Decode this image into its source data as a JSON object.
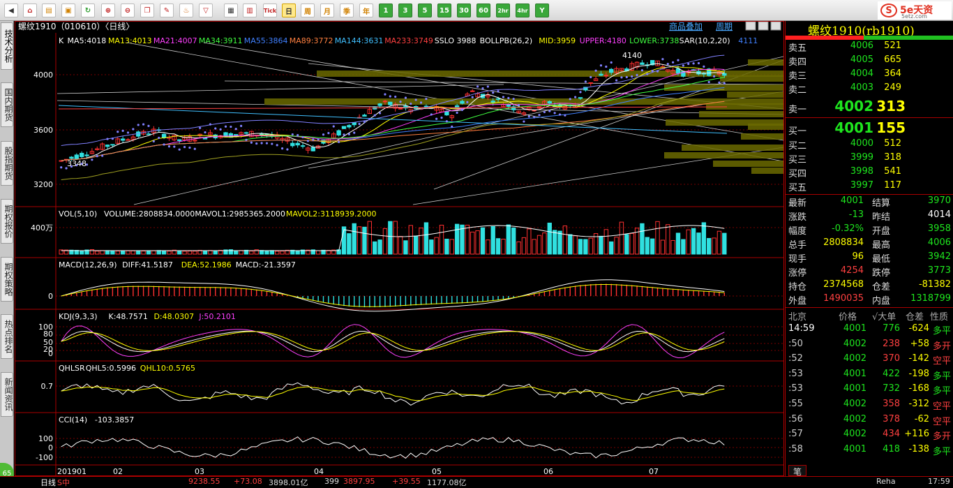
{
  "toolbar": {
    "buttons": [
      "back",
      "home",
      "folder",
      "stock",
      "refresh",
      "zoom-in",
      "zoom-out",
      "window",
      "pen",
      "flame",
      "filter",
      "table",
      "chart",
      "tick",
      "日",
      "周",
      "月",
      "季",
      "年",
      "1",
      "3",
      "5",
      "15",
      "30",
      "60",
      "2hr",
      "4hr",
      "Y"
    ]
  },
  "brand": {
    "name": "5e天资",
    "sub": "5etz.com"
  },
  "leftnav": [
    "技术分析",
    "国内期货",
    "股指期货",
    "期权报价",
    "期权策略",
    "热点排名",
    "新闻资讯"
  ],
  "chart": {
    "title": "螺纹1910（010610）〈日线〉",
    "topbtns": [
      "商品叠加",
      "周期"
    ],
    "ma_legend": [
      {
        "t": "K",
        "c": "#ffffff"
      },
      {
        "t": "MA5:4018",
        "c": "#ffffff"
      },
      {
        "t": "MA13:4013",
        "c": "#ffff00"
      },
      {
        "t": "MA21:4007",
        "c": "#ff40ff"
      },
      {
        "t": "MA34:3911",
        "c": "#40ff40"
      },
      {
        "t": "MA55:3864",
        "c": "#4080ff"
      },
      {
        "t": "MA89:3772",
        "c": "#ff8040"
      },
      {
        "t": "MA144:3631",
        "c": "#40c0ff"
      },
      {
        "t": "MA233:3749",
        "c": "#ff4040"
      },
      {
        "t": "SSLO 3988",
        "c": "#ffffff"
      },
      {
        "t": "BOLLPB(26,2)",
        "c": "#ffffff"
      },
      {
        "t": "MID:3959",
        "c": "#ffff00"
      },
      {
        "t": "UPPER:4180",
        "c": "#ff40ff"
      },
      {
        "t": "LOWER:3738",
        "c": "#40ff40"
      },
      {
        "t": "SAR(10,2,20)",
        "c": "#ffffff"
      },
      {
        "t": "4111",
        "c": "#4080ff"
      }
    ],
    "price_ticks": [
      "4000",
      "3600",
      "3200"
    ],
    "hi_label": "4140",
    "lo_label": "3348",
    "vol": {
      "legend": [
        {
          "t": "VOL(5,10)",
          "c": "#fff"
        },
        {
          "t": "VOLUME:2808834.0000",
          "c": "#fff"
        },
        {
          "t": "MAVOL1:2985365.2000",
          "c": "#fff"
        },
        {
          "t": "MAVOL2:3118939.2000",
          "c": "#ffff00"
        }
      ],
      "tick": "400万"
    },
    "macd": {
      "legend": [
        {
          "t": "MACD(12,26,9)",
          "c": "#fff"
        },
        {
          "t": "DIFF:41.5187",
          "c": "#fff"
        },
        {
          "t": "DEA:52.1986",
          "c": "#ffff00"
        },
        {
          "t": "MACD:-21.3597",
          "c": "#fff"
        }
      ],
      "tick": "0"
    },
    "kdj": {
      "legend": [
        {
          "t": "KDJ(9,3,3)",
          "c": "#fff"
        },
        {
          "t": "K:48.7571",
          "c": "#fff"
        },
        {
          "t": "D:48.0307",
          "c": "#ffff00"
        },
        {
          "t": "J:50.2101",
          "c": "#ff40ff"
        }
      ],
      "ticks": [
        "100",
        "80",
        "50",
        "20",
        "0"
      ]
    },
    "qhlsr": {
      "legend": [
        {
          "t": "QHLSR",
          "c": "#fff"
        },
        {
          "t": "QHL5:0.5996",
          "c": "#fff"
        },
        {
          "t": "QHL10:0.5765",
          "c": "#ffff00"
        }
      ],
      "tick": "0.7"
    },
    "cci": {
      "legend": [
        {
          "t": "CCI(14)",
          "c": "#fff"
        },
        {
          "t": "-103.3857",
          "c": "#fff"
        }
      ],
      "ticks": [
        "100",
        "0",
        "-100"
      ]
    },
    "dates": [
      "201901",
      "02",
      "03",
      "04",
      "05",
      "06",
      "07"
    ],
    "period_label": "日线"
  },
  "panel": {
    "title": "螺纹1910(rb1910)",
    "asks": [
      {
        "l": "卖五",
        "p": "4006",
        "v": "521"
      },
      {
        "l": "卖四",
        "p": "4005",
        "v": "665"
      },
      {
        "l": "卖三",
        "p": "4004",
        "v": "364"
      },
      {
        "l": "卖二",
        "p": "4003",
        "v": "249"
      },
      {
        "l": "卖一",
        "p": "4002",
        "v": "313"
      }
    ],
    "bids": [
      {
        "l": "买一",
        "p": "4001",
        "v": "155"
      },
      {
        "l": "买二",
        "p": "4000",
        "v": "512"
      },
      {
        "l": "买三",
        "p": "3999",
        "v": "318"
      },
      {
        "l": "买四",
        "p": "3998",
        "v": "541"
      },
      {
        "l": "买五",
        "p": "3997",
        "v": "117"
      }
    ],
    "stats": [
      {
        "l1": "最新",
        "v1": "4001",
        "c1": "g",
        "l2": "结算",
        "v2": "3970",
        "c2": "g"
      },
      {
        "l1": "涨跌",
        "v1": "-13",
        "c1": "g",
        "l2": "昨结",
        "v2": "4014",
        "c2": "w"
      },
      {
        "l1": "幅度",
        "v1": "-0.32%",
        "c1": "g",
        "l2": "开盘",
        "v2": "3958",
        "c2": "g"
      },
      {
        "l1": "总手",
        "v1": "2808834",
        "c1": "y",
        "l2": "最高",
        "v2": "4006",
        "c2": "g"
      },
      {
        "l1": "现手",
        "v1": "96",
        "c1": "y",
        "l2": "最低",
        "v2": "3942",
        "c2": "g"
      },
      {
        "l1": "涨停",
        "v1": "4254",
        "c1": "r",
        "l2": "跌停",
        "v2": "3773",
        "c2": "g"
      },
      {
        "l1": "持仓",
        "v1": "2374568",
        "c1": "y",
        "l2": "仓差",
        "v2": "-81382",
        "c2": "y"
      },
      {
        "l1": "外盘",
        "v1": "1490035",
        "c1": "r",
        "l2": "内盘",
        "v2": "1318799",
        "c2": "g"
      }
    ],
    "ticks_header": {
      "loc": "北京",
      "price": "价格",
      "vol": "√大单",
      "diff": "仓差",
      "nature": "性质"
    },
    "ticks": [
      {
        "t": "14:59",
        "p": "4001",
        "v": "776",
        "vc": "g",
        "d": "-624",
        "dc": "y",
        "n": "多平",
        "nc": "g"
      },
      {
        "t": ":50",
        "p": "4002",
        "v": "238",
        "vc": "r",
        "d": "+58",
        "dc": "y",
        "n": "多开",
        "nc": "r"
      },
      {
        "t": ":52",
        "p": "4002",
        "v": "370",
        "vc": "r",
        "d": "-142",
        "dc": "y",
        "n": "空平",
        "nc": "r"
      },
      {
        "t": ":53",
        "p": "4001",
        "v": "422",
        "vc": "g",
        "d": "-198",
        "dc": "y",
        "n": "多平",
        "nc": "g"
      },
      {
        "t": ":53",
        "p": "4001",
        "v": "732",
        "vc": "g",
        "d": "-168",
        "dc": "y",
        "n": "多平",
        "nc": "g"
      },
      {
        "t": ":55",
        "p": "4002",
        "v": "358",
        "vc": "r",
        "d": "-312",
        "dc": "y",
        "n": "空平",
        "nc": "r"
      },
      {
        "t": ":56",
        "p": "4002",
        "v": "378",
        "vc": "r",
        "d": "-62",
        "dc": "y",
        "n": "空平",
        "nc": "r"
      },
      {
        "t": ":57",
        "p": "4002",
        "v": "434",
        "vc": "r",
        "d": "+116",
        "dc": "y",
        "n": "多开",
        "nc": "r"
      },
      {
        "t": ":58",
        "p": "4001",
        "v": "418",
        "vc": "g",
        "d": "-138",
        "dc": "y",
        "n": "多平",
        "nc": "g"
      }
    ],
    "tab": "笔"
  },
  "bottom": {
    "items": [
      "65",
      "9238.55",
      "+73.08",
      "3898.01亿",
      "399",
      "3897.95",
      "+39.55",
      "1177.08亿",
      "Reha",
      "17:59"
    ]
  }
}
